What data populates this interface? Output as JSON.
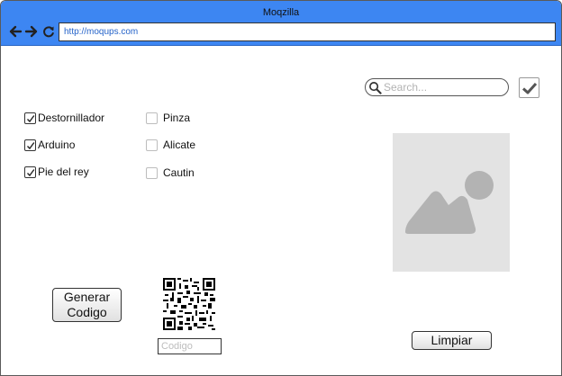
{
  "window": {
    "title": "Moqzilla"
  },
  "toolbar": {
    "back_icon": "arrow-left-icon",
    "forward_icon": "arrow-right-icon",
    "reload_icon": "reload-icon",
    "url": "http://moqups.com"
  },
  "search": {
    "placeholder": "Search...",
    "value": "",
    "icon": "search-icon"
  },
  "confirm": {
    "icon": "checkmark-icon",
    "checked": true
  },
  "checkboxes": {
    "left": [
      {
        "label": "Destornillador",
        "checked": true
      },
      {
        "label": "Arduino",
        "checked": true
      },
      {
        "label": "Pie del rey",
        "checked": true
      }
    ],
    "right": [
      {
        "label": "Pinza",
        "checked": false
      },
      {
        "label": "Alicate",
        "checked": false
      },
      {
        "label": "Cautin",
        "checked": false
      }
    ]
  },
  "image_placeholder": {
    "icon": "image-icon"
  },
  "actions": {
    "generate_label": "Generar Codigo",
    "clear_label": "Limpiar"
  },
  "qr": {
    "icon": "qr-code-icon"
  },
  "code_field": {
    "placeholder": "Codigo",
    "value": ""
  },
  "colors": {
    "titlebar": "#3d86f2",
    "url_text": "#2563c9",
    "placeholder_bg": "#e3e3e3",
    "placeholder_shape": "#b3b3b3"
  }
}
